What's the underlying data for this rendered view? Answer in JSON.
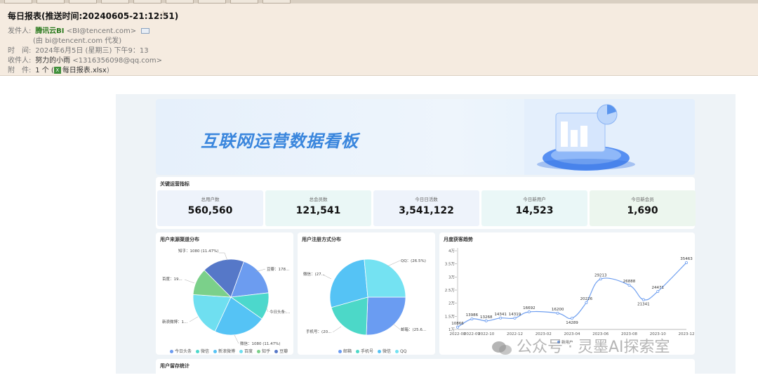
{
  "email": {
    "subject": "每日报表(推送时间:20240605-21:12:51)",
    "sender_label": "发件人:",
    "sender_name": "腾讯云BI",
    "sender_email": "<BI@tencent.com>",
    "proxy": "(由 bi@tencent.com 代发)",
    "time_label": "时　间:",
    "time_value": "2024年6月5日 (星期三) 下午9：13",
    "recipient_label": "收件人:",
    "recipient_name": "努力的小雨",
    "recipient_email": "<1316356098@qq.com>",
    "attach_label": "附　件:",
    "attach_count": "1 个 (",
    "attach_file": "每日报表.xlsx",
    "attach_close": ")"
  },
  "dashboard": {
    "title": "互联网运营数据看板",
    "kpi_section_title": "关键运营指标",
    "kpis": [
      {
        "label": "总用户数",
        "value": "560,560",
        "bg": "#eef3fb"
      },
      {
        "label": "总会员数",
        "value": "121,541",
        "bg": "#eaf7f6"
      },
      {
        "label": "今日日活数",
        "value": "3,541,122",
        "bg": "#eef3fb"
      },
      {
        "label": "今日新用户",
        "value": "14,523",
        "bg": "#eaf7f7"
      },
      {
        "label": "今日新会员",
        "value": "1,690",
        "bg": "#ecf6ee"
      }
    ],
    "retention_title": "用户留存统计"
  },
  "chart_data": [
    {
      "type": "pie",
      "title": "用户来源渠道分布",
      "slices": [
        {
          "name": "今日头条",
          "value": 17.5,
          "color": "#6c9cf0"
        },
        {
          "name": "微信",
          "value": 11.47,
          "color": "#4cd8cc"
        },
        {
          "name": "新浪微博",
          "value": 22.0,
          "color": "#55c3f5"
        },
        {
          "name": "百度",
          "value": 19.0,
          "color": "#6fdff0"
        },
        {
          "name": "知乎",
          "value": 11.47,
          "color": "#7bd08a"
        },
        {
          "name": "豆瓣",
          "value": 17.8,
          "color": "#5678c8"
        }
      ],
      "labels": {
        "zhihu": "知乎：1080 (11.47%)",
        "douban": "豆瓣：178...",
        "baidu": "百度：19...",
        "toutiao": "今日头条:...",
        "weibo": "新浪微博：1...",
        "weixin": "微信：1080 (11.47%)"
      }
    },
    {
      "type": "pie",
      "title": "用户注册方式分布",
      "slices": [
        {
          "name": "邮箱",
          "value": 25.6,
          "color": "#6a9cf2"
        },
        {
          "name": "手机号",
          "value": 20.0,
          "color": "#4cd8c8"
        },
        {
          "name": "微信",
          "value": 27.9,
          "color": "#55c3f5"
        },
        {
          "name": "QQ",
          "value": 26.5,
          "color": "#74e2f2"
        }
      ],
      "labels": {
        "qq": "QQ：(26.5%)",
        "weixin": "微信：(27...",
        "email": "邮箱：(25.6...",
        "phone": "手机号：(20..."
      }
    },
    {
      "type": "line",
      "title": "月度获客趋势",
      "legend": "新用户",
      "x": [
        "2022-08",
        "2022-09",
        "2022-10",
        "2022-11",
        "2022-12",
        "2023-01",
        "2023-02",
        "2023-03",
        "2023-04",
        "2023-05",
        "2023-06",
        "2023-07",
        "2023-08",
        "2023-09",
        "2023-10",
        "2023-11",
        "2023-12"
      ],
      "x_ticks": [
        "2022-08",
        "2022-09",
        "2022-10",
        "2022-12",
        "2023-02",
        "2023-04",
        "2023-06",
        "2023-08",
        "2023-10",
        "2023-12"
      ],
      "y": [
        10866,
        13986,
        13268,
        14341,
        14319,
        16692,
        16200,
        14289,
        20226,
        29213,
        26888,
        21341,
        24471,
        35463
      ],
      "y_x": [
        "2022-08",
        "2022-09",
        "2022-10",
        "2022-11",
        "2022-12",
        "2023-01",
        "2023-03",
        "2023-04",
        "2023-05",
        "2023-06",
        "2023-08",
        "2023-09",
        "2023-10",
        "2023-12"
      ],
      "y_ticks": [
        "1万",
        "1.5万",
        "2万",
        "2.5万",
        "3万",
        "3.5万",
        "4万"
      ],
      "ylim": [
        10000,
        40000
      ]
    }
  ],
  "watermark": "公众号 · 灵墨AI探索室"
}
